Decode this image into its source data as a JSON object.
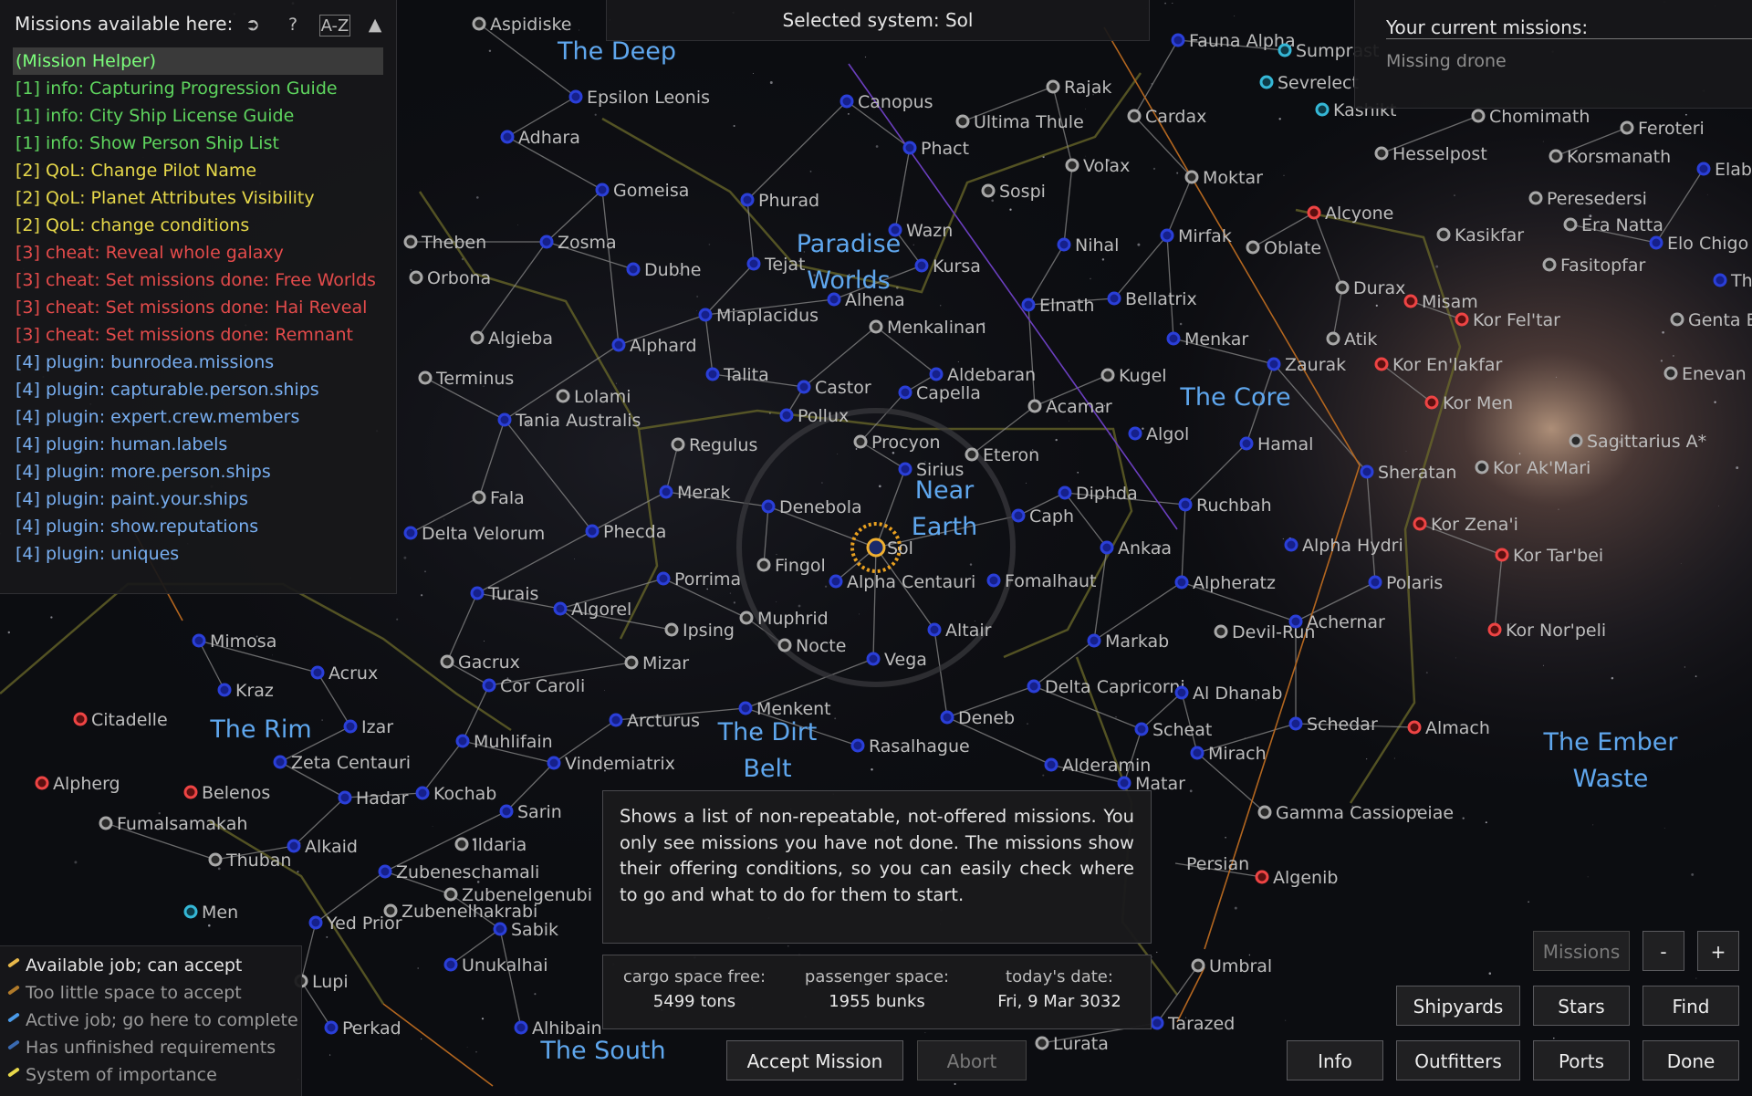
{
  "selected_system": "Selected system: Sol",
  "available_missions": {
    "header": "Missions available here:",
    "sort_button": "A-Z",
    "items": [
      {
        "label": "(Mission Helper)",
        "color": "#7cff7c"
      },
      {
        "label": "[1] info: Capturing Progression Guide",
        "color": "#5ed45e"
      },
      {
        "label": "[1] info: City Ship License Guide",
        "color": "#5ed45e"
      },
      {
        "label": "[1] info: Show Person Ship List",
        "color": "#5ed45e"
      },
      {
        "label": "[2] QoL: Change Pilot Name",
        "color": "#e6d84a"
      },
      {
        "label": "[2] QoL: Planet Attributes Visibility",
        "color": "#e6d84a"
      },
      {
        "label": "[2] QoL: change conditions",
        "color": "#e6d84a"
      },
      {
        "label": "[3] cheat: Reveal whole galaxy",
        "color": "#e44b4b"
      },
      {
        "label": "[3] cheat: Set missions done: Free Worlds",
        "color": "#e44b4b"
      },
      {
        "label": "[3] cheat: Set missions done: Hai Reveal",
        "color": "#e44b4b"
      },
      {
        "label": "[3] cheat: Set missions done: Remnant",
        "color": "#e44b4b"
      },
      {
        "label": "[4] plugin: bunrodea.missions",
        "color": "#78aef0"
      },
      {
        "label": "[4] plugin: capturable.person.ships",
        "color": "#78aef0"
      },
      {
        "label": "[4] plugin: expert.crew.members",
        "color": "#78aef0"
      },
      {
        "label": "[4] plugin: human.labels",
        "color": "#78aef0"
      },
      {
        "label": "[4] plugin: more.person.ships",
        "color": "#78aef0"
      },
      {
        "label": "[4] plugin: paint.your.ships",
        "color": "#78aef0"
      },
      {
        "label": "[4] plugin: show.reputations",
        "color": "#78aef0"
      },
      {
        "label": "[4] plugin: uniques",
        "color": "#78aef0"
      }
    ]
  },
  "current_missions": {
    "title": "Your current missions:",
    "items": [
      "Missing drone"
    ]
  },
  "description": "Shows a list of non-repeatable, not-offered missions. You only see missions you have not done. The missions show their offering conditions, so you can easily check where to go and what to do for them to start.",
  "stats": {
    "cargo_label": "cargo space free:",
    "cargo_value": "5499 tons",
    "passenger_label": "passenger space:",
    "passenger_value": "1955 bunks",
    "date_label": "today's date:",
    "date_value": "Fri, 9 Mar 3032"
  },
  "buttons": {
    "accept": "Accept Mission",
    "abort": "Abort",
    "missions": "Missions",
    "zoom_out": "-",
    "zoom_in": "+",
    "shipyards": "Shipyards",
    "stars": "Stars",
    "find": "Find",
    "info": "Info",
    "outfitters": "Outfitters",
    "ports": "Ports",
    "done": "Done"
  },
  "legend": [
    {
      "label": "Available job; can accept",
      "color": "#e8b84a",
      "text": "#e6e6e6"
    },
    {
      "label": "Too little space to accept",
      "color": "#b07a2a",
      "text": "#9a9a9a"
    },
    {
      "label": "Active job; go here to complete",
      "color": "#4a9ae8",
      "text": "#9a9a9a"
    },
    {
      "label": "Has unfinished requirements",
      "color": "#3a6ab0",
      "text": "#9a9a9a"
    },
    {
      "label": "System of importance",
      "color": "#e8d84a",
      "text": "#9a9a9a"
    }
  ],
  "governments": [
    "The Deep",
    "Paradise Worlds",
    "Near Earth",
    "The Core",
    "The Rim",
    "The Dirt Belt",
    "The South",
    "The Ember Waste"
  ],
  "systems": [
    "Aspidiske",
    "Epsilon Leonis",
    "Adhara",
    "Gomeisa",
    "Zosma",
    "Dubhe",
    "Theben",
    "Orbona",
    "Algieba",
    "Alphard",
    "Terminus",
    "Lolami",
    "Tania Australis",
    "Fala",
    "Delta Velorum",
    "Phecda",
    "Merak",
    "Regulus",
    "Turais",
    "Algorel",
    "Porrima",
    "Muphrid",
    "Ipsing",
    "Nocte",
    "Gacrux",
    "Cor Caroli",
    "Mizar",
    "Mimosa",
    "Acrux",
    "Kraz",
    "Citadelle",
    "Izar",
    "Zeta Centauri",
    "Alpherg",
    "Belenos",
    "Hadar",
    "Kochab",
    "Fumalsamakah",
    "Thuban",
    "Alkaid",
    "Muhlifain",
    "Vindemiatrix",
    "Sarin",
    "Ildaria",
    "Zubeneschamali",
    "Zubenelgenubi",
    "Zubenelhakrabi",
    "Men",
    "Yed Prior",
    "Sabik",
    "Unukalhai",
    "Lupi",
    "Perkad",
    "Alhibain",
    "Phurad",
    "Tejat",
    "Miaplacidus",
    "Talita",
    "Castor",
    "Pollux",
    "Canopus",
    "Phact",
    "Wazn",
    "Kursa",
    "Alhena",
    "Menkalinan",
    "Aldebaran",
    "Capella",
    "Procyon",
    "Sirius",
    "Eteron",
    "Denebola",
    "Fingol",
    "Sol",
    "Alpha Centauri",
    "Fomalhaut",
    "Altair",
    "Vega",
    "Menkent",
    "Arcturus",
    "Rasalhague",
    "Deneb",
    "Caph",
    "Diphda",
    "Ankaa",
    "Ultima Thule",
    "Rajak",
    "Sospi",
    "Volax",
    "Nihal",
    "Elnath",
    "Kugel",
    "Acamar",
    "Cardax",
    "Moktar",
    "Mirfak",
    "Bellatrix",
    "Menkar",
    "Oblate",
    "Zaurak",
    "Algol",
    "Hamal",
    "Ruchbah",
    "Alpha Hydri",
    "Alpheratz",
    "Devil-Run",
    "Achernar",
    "Polaris",
    "Markab",
    "Delta Capricorni",
    "Al Dhanab",
    "Scheat",
    "Schedar",
    "Mirach",
    "Alderamin",
    "Matar",
    "Gamma Cassiopeiae",
    "Almach",
    "Algenib",
    "Persian",
    "Umbral",
    "Tarazed",
    "Lurata",
    "Sheratan",
    "Alcyone",
    "Durax",
    "Atik",
    "Misam",
    "Kor Fel'tar",
    "Kor En'lakfar",
    "Kor Men",
    "Kor Zena'i",
    "Kor Tar'bei",
    "Kor Nor'peli",
    "Kor Ak'Mari",
    "Sagittarius A*",
    "Fauna Alpha",
    "Sumprast",
    "Sevrelect",
    "Kashikt",
    "Chomimath",
    "Hesselpost",
    "Feroteri",
    "Korsmanath",
    "Peresedersi",
    "Kasikfar",
    "Era Natta",
    "Elo Chigo",
    "Fasitopfar",
    "Genta B",
    "Enevan",
    "Elab",
    "Th"
  ]
}
